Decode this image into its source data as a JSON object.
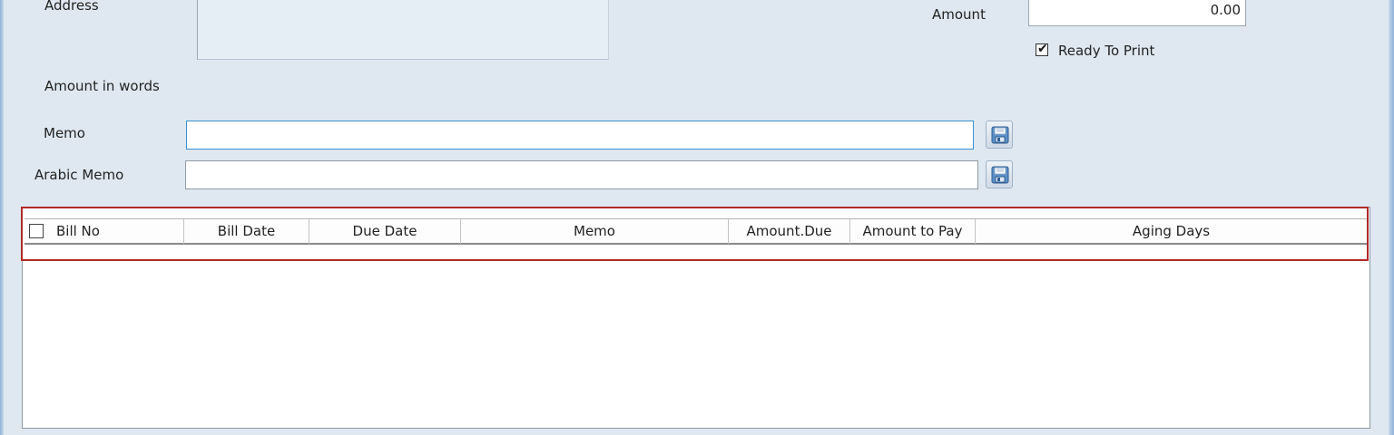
{
  "form": {
    "address_label": "Address",
    "amount_label": "Amount",
    "amount_value": "0.00",
    "ready_to_print_label": "Ready To Print",
    "ready_to_print_checked": true,
    "amount_in_words_label": "Amount in words",
    "memo_label": "Memo",
    "memo_value": "",
    "arabic_memo_label": "Arabic Memo",
    "arabic_memo_value": ""
  },
  "grid": {
    "columns": [
      "Bill No",
      "Bill Date",
      "Due Date",
      "Memo",
      "Amount.Due",
      "Amount to Pay",
      "Aging Days"
    ],
    "rows": []
  },
  "icons": {
    "save": "save-icon"
  },
  "colors": {
    "background": "#dfe8f1",
    "highlight": "#b02a2a",
    "focus_border": "#3b8fd1"
  }
}
